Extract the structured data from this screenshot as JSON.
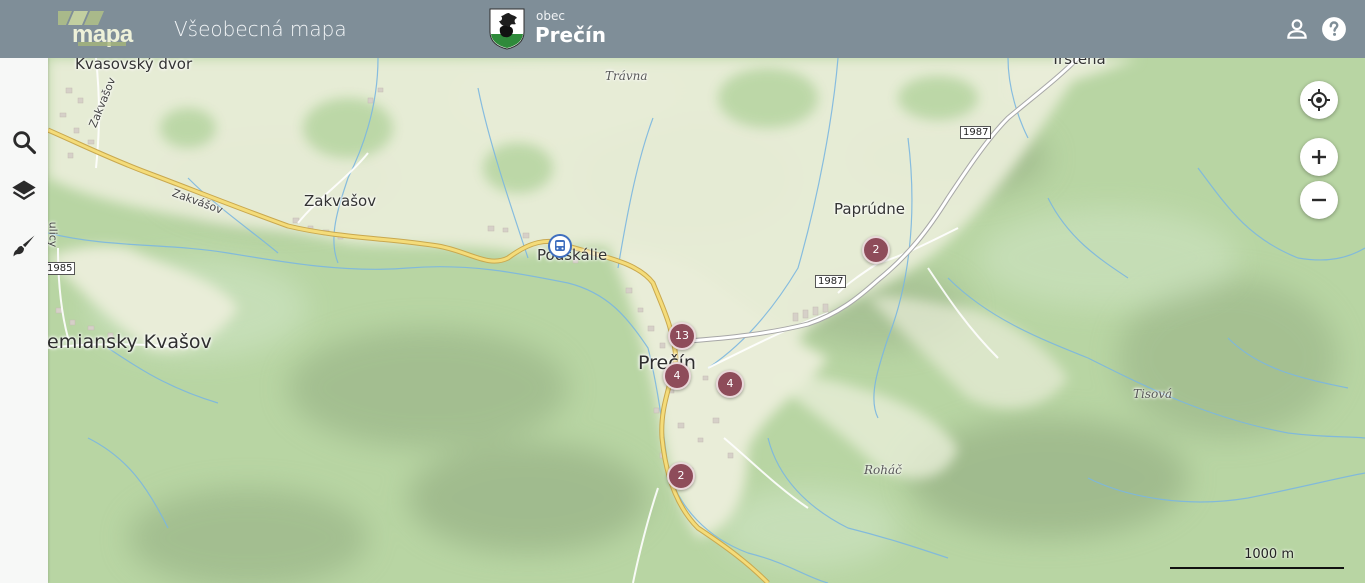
{
  "header": {
    "logo_text": "mapa",
    "app_title": "Všeobecná mapa",
    "municipality_type": "obec",
    "municipality_name": "Prečín",
    "icons": {
      "user": "account-icon",
      "help": "help-icon"
    }
  },
  "sidebar": {
    "tools": [
      {
        "name": "search",
        "icon": "search-icon"
      },
      {
        "name": "layers",
        "icon": "layers-icon"
      },
      {
        "name": "draw",
        "icon": "brush-icon"
      }
    ]
  },
  "map": {
    "places": {
      "precin": "Prečín",
      "zemiansky_kvasov": "Zemiansky Kvašov",
      "zakvasov": "Zakvašov",
      "kvasovsky_dvor": "Kvasovský dvor",
      "podskalie": "Podskálie",
      "paprudne": "Paprúdne",
      "trstena": "Trstená",
      "travna": "Trávna",
      "tisova": "Tisová",
      "rohac": "Roháč",
      "zakvasov_road": "Zakvášov",
      "zakvasov_road_2": "Zakvašov",
      "ulicy": "ulicy"
    },
    "road_numbers": {
      "r1": "1987",
      "r2": "1987",
      "r3": "1985"
    },
    "clusters": [
      {
        "id": "c1",
        "count": "13"
      },
      {
        "id": "c2",
        "count": "4"
      },
      {
        "id": "c3",
        "count": "4"
      },
      {
        "id": "c4",
        "count": "2"
      },
      {
        "id": "c5",
        "count": "2"
      }
    ],
    "bus_stop_icon": "bus-icon"
  },
  "controls": {
    "locate_icon": "crosshair-icon",
    "zoom_in_icon": "plus-icon",
    "zoom_out_icon": "minus-icon"
  },
  "scale": {
    "label": "1000 m"
  },
  "colors": {
    "header": "#7f8e98",
    "forest": "#b9d7a6",
    "meadow": "#e8ecd6",
    "cluster": "#8e4c5a",
    "road": "#f4dc7a",
    "stream": "#7cb7e0"
  }
}
